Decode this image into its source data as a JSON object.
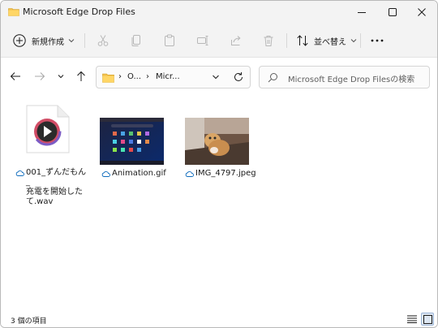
{
  "window": {
    "title": "Microsoft Edge Drop Files"
  },
  "toolbar": {
    "new_label": "新規作成",
    "sort_label": "並べ替え"
  },
  "address": {
    "part1": "O...",
    "part2": "Micr...",
    "search_placeholder": "Microsoft Edge Drop Filesの検索"
  },
  "files": [
    {
      "name_lines": [
        "001_ずんだもん_",
        "充電を開始した",
        "て.wav"
      ],
      "type": "audio"
    },
    {
      "name_lines": [
        "Animation.gif"
      ],
      "type": "image"
    },
    {
      "name_lines": [
        "IMG_4797.jpeg"
      ],
      "type": "image"
    }
  ],
  "status": {
    "item_count": "3 個の項目"
  },
  "colors": {
    "accent": "#005fb8",
    "folder": "#f2c04e",
    "cloud": "#0f6cbd"
  }
}
